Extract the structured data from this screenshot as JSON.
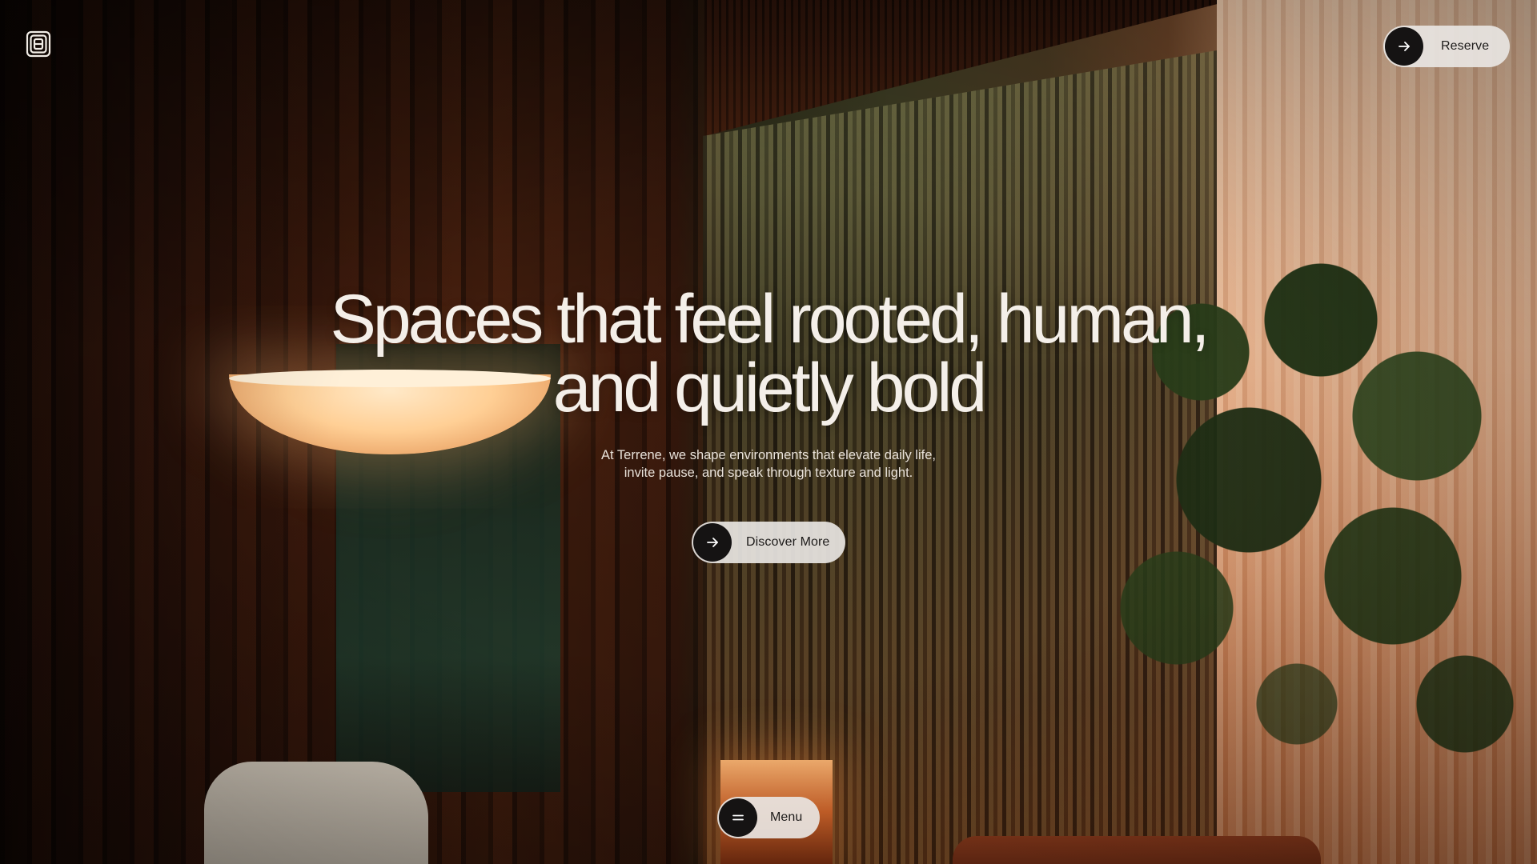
{
  "brand": {
    "logo_icon": "square-spiral-logo"
  },
  "header": {
    "reserve_label": "Reserve",
    "reserve_icon": "arrow-right-icon"
  },
  "hero": {
    "headline_line1": "Spaces that feel rooted, human,",
    "headline_line2": "and quietly bold",
    "subtitle_line1": "At Terrene, we shape environments that elevate daily life,",
    "subtitle_line2": "invite pause, and speak through texture and light.",
    "cta_label": "Discover More",
    "cta_icon": "arrow-right-icon"
  },
  "nav": {
    "menu_label": "Menu",
    "menu_icon": "hamburger-icon"
  },
  "colors": {
    "pill_background": "#e8e5e2",
    "pill_icon_circle": "#151313",
    "headline_text": "#f4efe9"
  }
}
